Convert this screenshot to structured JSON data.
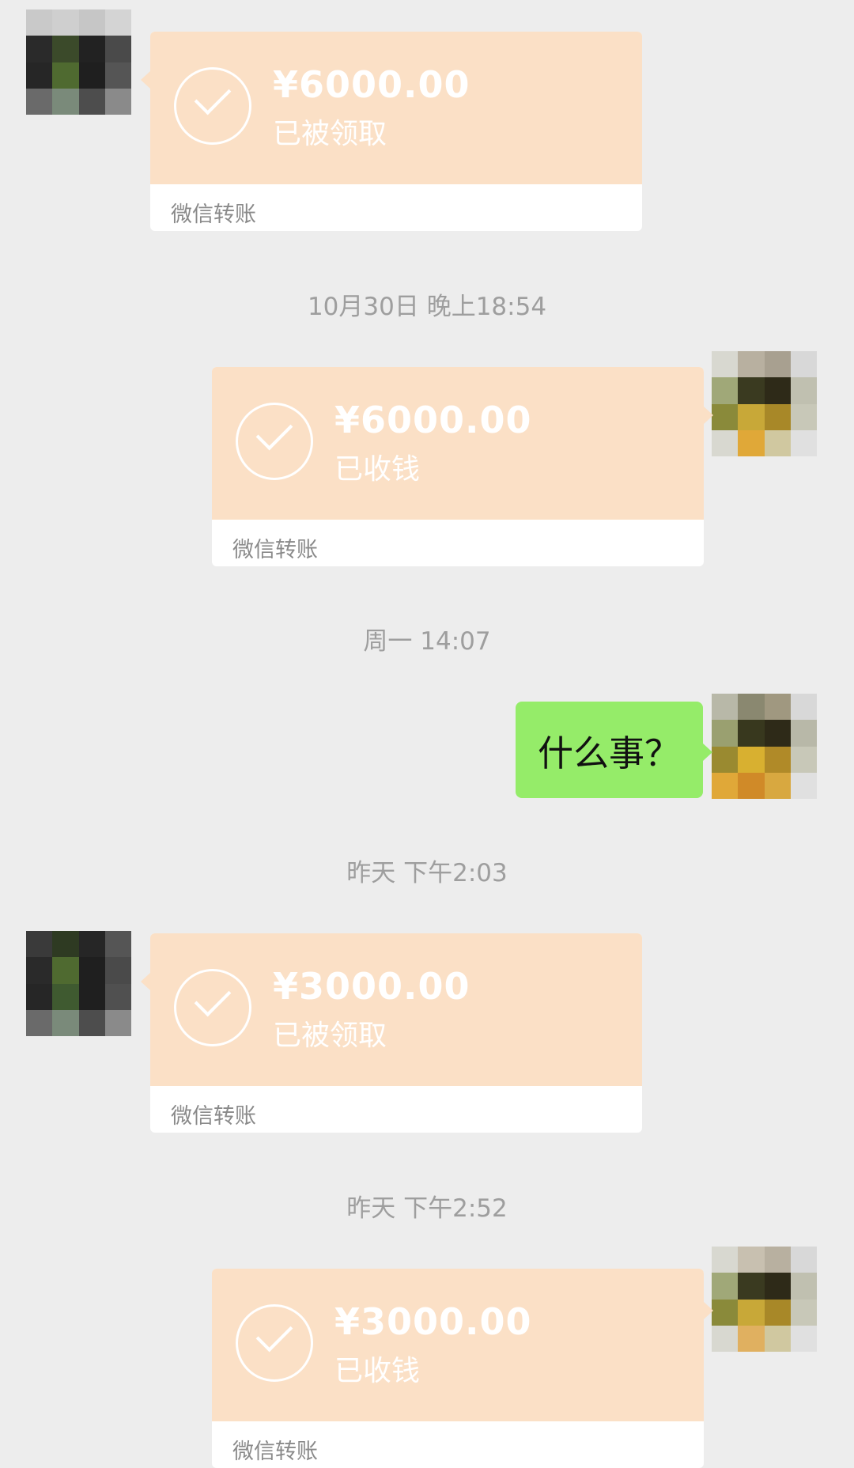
{
  "messages": [
    {
      "type": "transfer",
      "side": "left",
      "amount": "¥6000.00",
      "status": "已被领取",
      "label": "微信转账"
    },
    {
      "type": "timestamp",
      "text": "10月30日 晚上18:54"
    },
    {
      "type": "transfer",
      "side": "right",
      "amount": "¥6000.00",
      "status": "已收钱",
      "label": "微信转账"
    },
    {
      "type": "timestamp",
      "text": "周一 14:07"
    },
    {
      "type": "text",
      "side": "right",
      "text": "什么事？"
    },
    {
      "type": "timestamp",
      "text": "昨天 下午2:03"
    },
    {
      "type": "transfer",
      "side": "left",
      "amount": "¥3000.00",
      "status": "已被领取",
      "label": "微信转账"
    },
    {
      "type": "timestamp",
      "text": "昨天 下午2:52"
    },
    {
      "type": "transfer",
      "side": "right",
      "amount": "¥3000.00",
      "status": "已收钱",
      "label": "微信转账"
    }
  ],
  "colors": {
    "transfer_bg": "#fbe0c6",
    "bubble_green": "#95ec69",
    "background": "#ededed"
  },
  "icons": {
    "transfer": "check-circle-icon",
    "avatar": "pixelated-avatar"
  }
}
